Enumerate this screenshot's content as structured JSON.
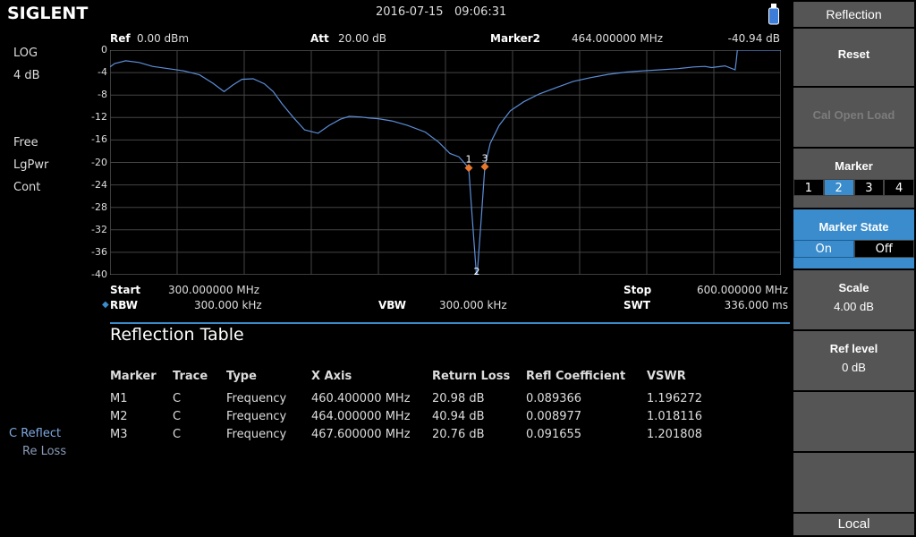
{
  "header": {
    "brand": "SIGLENT",
    "datetime": "2016-07-15   09:06:31"
  },
  "left_panel": {
    "scale_type": "LOG",
    "scale_div": "4 dB",
    "trig": "Free",
    "detector": "LgPwr",
    "sweep_mode": "Cont",
    "meas_reflect": "C Reflect",
    "meas_reloss": "Re Loss"
  },
  "top_info": {
    "ref_label": "Ref",
    "ref_value": "0.00 dBm",
    "att_label": "Att",
    "att_value": "20.00 dB",
    "marker_label": "Marker2",
    "marker_freq": "464.000000 MHz",
    "marker_level": "-40.94 dB"
  },
  "bottom_info": {
    "start_label": "Start",
    "start_value": "300.000000 MHz",
    "stop_label": "Stop",
    "stop_value": "600.000000 MHz",
    "rbw_label": "RBW",
    "rbw_value": "300.000 kHz",
    "vbw_label": "VBW",
    "vbw_value": "300.000 kHz",
    "swt_label": "SWT",
    "swt_value": "336.000 ms"
  },
  "chart_data": {
    "type": "line",
    "xlim": [
      300,
      600
    ],
    "ylim": [
      -40,
      0
    ],
    "yticks": [
      "0",
      "-4",
      "-8",
      "-12",
      "-16",
      "-20",
      "-24",
      "-28",
      "-32",
      "-36",
      "-40"
    ],
    "grid": true,
    "x": [
      300,
      302,
      307,
      313,
      319,
      326,
      333,
      340,
      346,
      351,
      355,
      359,
      364,
      369,
      373,
      377,
      382,
      387,
      393,
      398,
      403,
      407,
      412,
      416,
      420,
      426,
      433,
      441,
      447,
      452,
      456,
      460.4,
      462,
      464,
      466,
      467.6,
      470,
      474,
      479,
      485,
      492,
      500,
      507,
      515,
      523,
      531,
      538,
      546,
      554,
      561,
      566,
      569,
      575,
      579.5,
      580,
      580.5,
      590,
      600
    ],
    "y": [
      -3.0,
      -2.4,
      -1.9,
      -2.2,
      -2.9,
      -3.3,
      -3.7,
      -4.4,
      -5.9,
      -7.4,
      -6.2,
      -5.2,
      -5.1,
      -6.0,
      -7.4,
      -9.6,
      -12.0,
      -14.2,
      -14.8,
      -13.4,
      -12.3,
      -11.8,
      -11.9,
      -12.1,
      -12.2,
      -12.6,
      -13.4,
      -14.6,
      -16.4,
      -18.4,
      -19.0,
      -20.98,
      -30,
      -40.94,
      -30,
      -20.76,
      -16.6,
      -13.4,
      -10.8,
      -9.2,
      -7.8,
      -6.6,
      -5.6,
      -4.9,
      -4.3,
      -3.9,
      -3.7,
      -3.5,
      -3.3,
      -3.0,
      -2.9,
      -3.1,
      -2.8,
      -3.5,
      -2.0,
      0,
      0,
      0
    ],
    "color": "#5b8ed8",
    "markers": [
      {
        "label": "1",
        "x": 460.4,
        "y": -20.98
      },
      {
        "label": "2",
        "x": 464.0,
        "y": -40.94
      },
      {
        "label": "3",
        "x": 467.6,
        "y": -20.76
      }
    ],
    "marker_color": "#e8772e"
  },
  "table": {
    "title": "Reflection Table",
    "columns": [
      "Marker",
      "Trace",
      "Type",
      "X Axis",
      "Return Loss",
      "Refl Coefficient",
      "VSWR"
    ],
    "rows": [
      [
        "M1",
        "C",
        "Frequency",
        "460.400000 MHz",
        "20.98 dB",
        "0.089366",
        "1.196272"
      ],
      [
        "M2",
        "C",
        "Frequency",
        "464.000000 MHz",
        "40.94 dB",
        "0.008977",
        "1.018116"
      ],
      [
        "M3",
        "C",
        "Frequency",
        "467.600000 MHz",
        "20.76 dB",
        "0.091655",
        "1.201808"
      ]
    ]
  },
  "menu": {
    "title": "Reflection",
    "reset": "Reset",
    "cal": "Cal Open Load",
    "marker_label": "Marker",
    "marker_options": [
      "1",
      "2",
      "3",
      "4"
    ],
    "marker_selected": "2",
    "marker_state_label": "Marker State",
    "state_on": "On",
    "state_off": "Off",
    "scale_label": "Scale",
    "scale_value": "4.00 dB",
    "ref_level_label": "Ref level",
    "ref_level_value": "0 dB",
    "local": "Local"
  }
}
